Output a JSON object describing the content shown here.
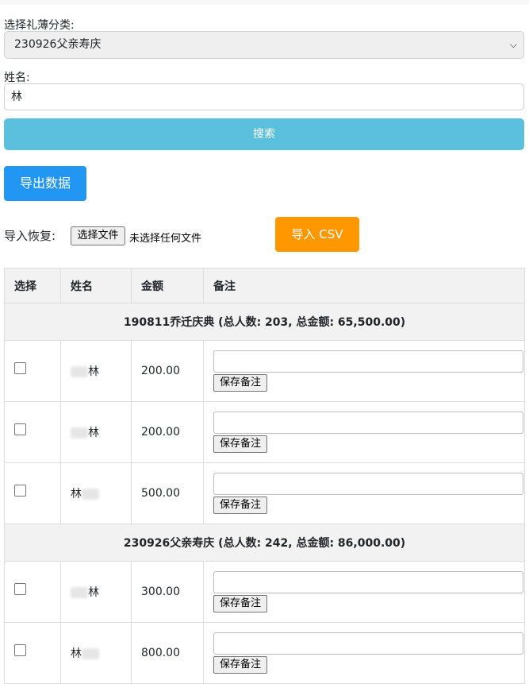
{
  "form": {
    "category_label": "选择礼薄分类:",
    "category_value": "230926父亲寿庆",
    "name_label": "姓名:",
    "name_value": "林",
    "search_label": "搜索"
  },
  "actions": {
    "export_label": "导出数据",
    "restore_label": "导入恢复:",
    "file_button_label": "选择文件",
    "file_none_label": "未选择任何文件",
    "import_label": "导入 CSV"
  },
  "table": {
    "headers": [
      "选择",
      "姓名",
      "金额",
      "备注"
    ],
    "save_label": "保存备注",
    "groups": [
      {
        "title": "190811乔迁庆典 (总人数: 203, 总金额: 65,500.00)",
        "rows": [
          {
            "name": "林",
            "amount": "200.00"
          },
          {
            "name": "林",
            "amount": "200.00"
          },
          {
            "name": "林",
            "amount": "500.00"
          }
        ]
      },
      {
        "title": "230926父亲寿庆 (总人数: 242, 总金额: 86,000.00)",
        "rows": [
          {
            "name": "林",
            "amount": "300.00"
          },
          {
            "name": "林",
            "amount": "800.00"
          }
        ]
      }
    ]
  },
  "colors": {
    "search_button": "#5bc0de",
    "export_button": "#2196f3",
    "import_button": "#ff9800"
  }
}
